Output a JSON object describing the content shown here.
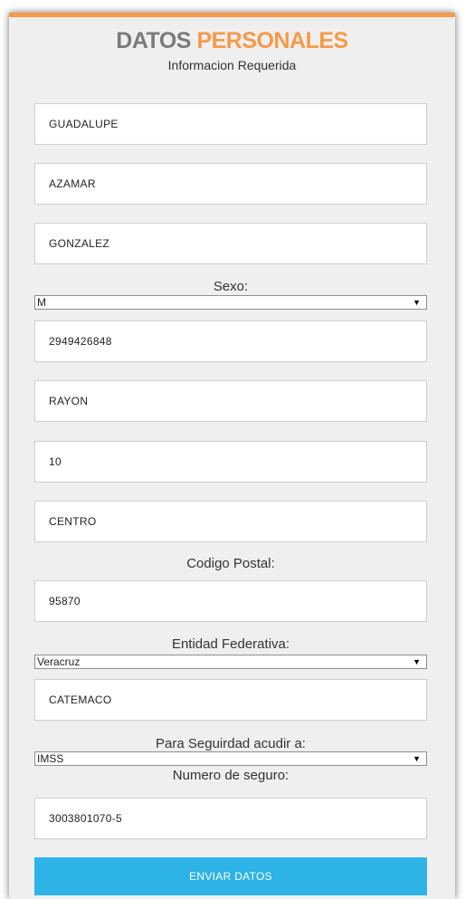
{
  "header": {
    "title_part1": "DATOS",
    "title_part2": "PERSONALES",
    "subtitle": "Informacion Requerida"
  },
  "form": {
    "nombre": "GUADALUPE",
    "apellido_paterno": "AZAMAR",
    "apellido_materno": "GONZALEZ",
    "sexo_label": "Sexo:",
    "sexo_value": "M",
    "telefono": "2949426848",
    "calle": "RAYON",
    "numero": "10",
    "colonia": "CENTRO",
    "cp_label": "Codigo Postal:",
    "cp_value": "95870",
    "entidad_label": "Entidad Federativa:",
    "entidad_value": "Veracruz",
    "municipio": "CATEMACO",
    "seguridad_label": "Para Seguirdad acudir a:",
    "seguridad_value": "IMSS",
    "numero_seguro_label": "Numero de seguro:",
    "numero_seguro_value": "3003801070-5",
    "submit_label": "ENVIAR DATOS"
  },
  "colors": {
    "accent_orange": "#f59a4a",
    "title_gray": "#7b7b7b",
    "button_blue": "#2db3e6",
    "panel_bg": "#efefef"
  },
  "icons": {
    "select_arrow": "triangle-down-icon"
  }
}
